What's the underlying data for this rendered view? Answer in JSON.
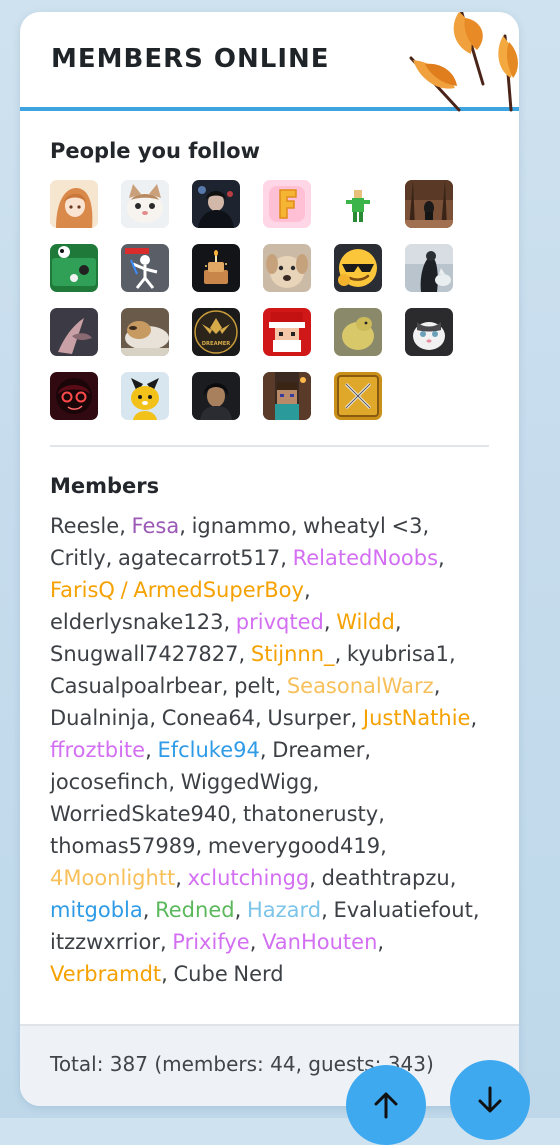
{
  "card": {
    "title": "MEMBERS ONLINE"
  },
  "following": {
    "title": "People you follow",
    "avatars": [
      {
        "name": "avatar-anime-girl"
      },
      {
        "name": "avatar-cat"
      },
      {
        "name": "avatar-dark-figure"
      },
      {
        "name": "avatar-letter-f"
      },
      {
        "name": "avatar-green-figure"
      },
      {
        "name": "avatar-forest"
      },
      {
        "name": "avatar-pool-table"
      },
      {
        "name": "avatar-stick-figure"
      },
      {
        "name": "avatar-cake"
      },
      {
        "name": "avatar-dog"
      },
      {
        "name": "avatar-cool-emoji"
      },
      {
        "name": "avatar-wolf"
      },
      {
        "name": "avatar-hand"
      },
      {
        "name": "avatar-sleeping-dog"
      },
      {
        "name": "avatar-dreamer-logo"
      },
      {
        "name": "avatar-santa-block"
      },
      {
        "name": "avatar-yellow-blob"
      },
      {
        "name": "avatar-cat-face"
      },
      {
        "name": "avatar-red-eyes"
      },
      {
        "name": "avatar-fox"
      },
      {
        "name": "avatar-dark-hair"
      },
      {
        "name": "avatar-minecraft-steve"
      },
      {
        "name": "avatar-crossed-swords"
      }
    ],
    "logo_text": "DREAMER"
  },
  "members": {
    "title": "Members",
    "list": [
      {
        "name": "Reesle",
        "color": "#3d4146"
      },
      {
        "name": "Fesa",
        "color": "#9b59b6"
      },
      {
        "name": "ignammo",
        "color": "#3d4146"
      },
      {
        "name": "wheatyl <3",
        "color": "#3d4146"
      },
      {
        "name": "Critly",
        "color": "#3d4146"
      },
      {
        "name": "agatecarrot517",
        "color": "#3d4146"
      },
      {
        "name": "RelatedNoobs",
        "color": "#d36ff2"
      },
      {
        "name": "FarisQ / ArmedSuperBoy",
        "color": "#f5a100"
      },
      {
        "name": "elderlysnake123",
        "color": "#3d4146"
      },
      {
        "name": "privqted",
        "color": "#d36ff2"
      },
      {
        "name": "Wildd",
        "color": "#f5a100"
      },
      {
        "name": "Snugwall7427827",
        "color": "#3d4146"
      },
      {
        "name": "Stijnnn_",
        "color": "#f5a100"
      },
      {
        "name": "kyubrisa1",
        "color": "#3d4146"
      },
      {
        "name": "Casualpoalrbear",
        "color": "#3d4146"
      },
      {
        "name": "pelt",
        "color": "#3d4146"
      },
      {
        "name": "SeasonalWarz",
        "color": "#f7c05a"
      },
      {
        "name": "Dualninja",
        "color": "#3d4146"
      },
      {
        "name": "Conea64",
        "color": "#3d4146"
      },
      {
        "name": "Usurper",
        "color": "#3d4146"
      },
      {
        "name": "JustNathie",
        "color": "#f5a100"
      },
      {
        "name": "ffroztbite",
        "color": "#d36ff2"
      },
      {
        "name": "Efcluke94",
        "color": "#2f9be6"
      },
      {
        "name": "Dreamer",
        "color": "#3d4146"
      },
      {
        "name": "jocosefinch",
        "color": "#3d4146"
      },
      {
        "name": "WiggedWigg",
        "color": "#3d4146"
      },
      {
        "name": "WorriedSkate940",
        "color": "#3d4146"
      },
      {
        "name": "thatonerusty",
        "color": "#3d4146"
      },
      {
        "name": "thomas57989",
        "color": "#3d4146"
      },
      {
        "name": "meverygood419",
        "color": "#3d4146"
      },
      {
        "name": "4Moonlightt",
        "color": "#f7c05a"
      },
      {
        "name": "xclutchingg",
        "color": "#d36ff2"
      },
      {
        "name": "deathtrapzu",
        "color": "#3d4146"
      },
      {
        "name": "mitgobla",
        "color": "#2f9be6"
      },
      {
        "name": "Redned",
        "color": "#5cb85c"
      },
      {
        "name": "Hazard",
        "color": "#7cc4e8"
      },
      {
        "name": "Evaluatiefout",
        "color": "#3d4146"
      },
      {
        "name": "itzzwxrrior",
        "color": "#3d4146"
      },
      {
        "name": "Prixifye",
        "color": "#d36ff2"
      },
      {
        "name": "VanHouten",
        "color": "#d36ff2"
      },
      {
        "name": "Verbramdt",
        "color": "#f5a100"
      },
      {
        "name": "Cube Nerd",
        "color": "#3d4146"
      }
    ]
  },
  "footer": {
    "total_text": "Total: 387 (members: 44, guests: 343)"
  },
  "scroll": {
    "up_icon": "arrow-up-icon",
    "down_icon": "arrow-down-icon"
  }
}
